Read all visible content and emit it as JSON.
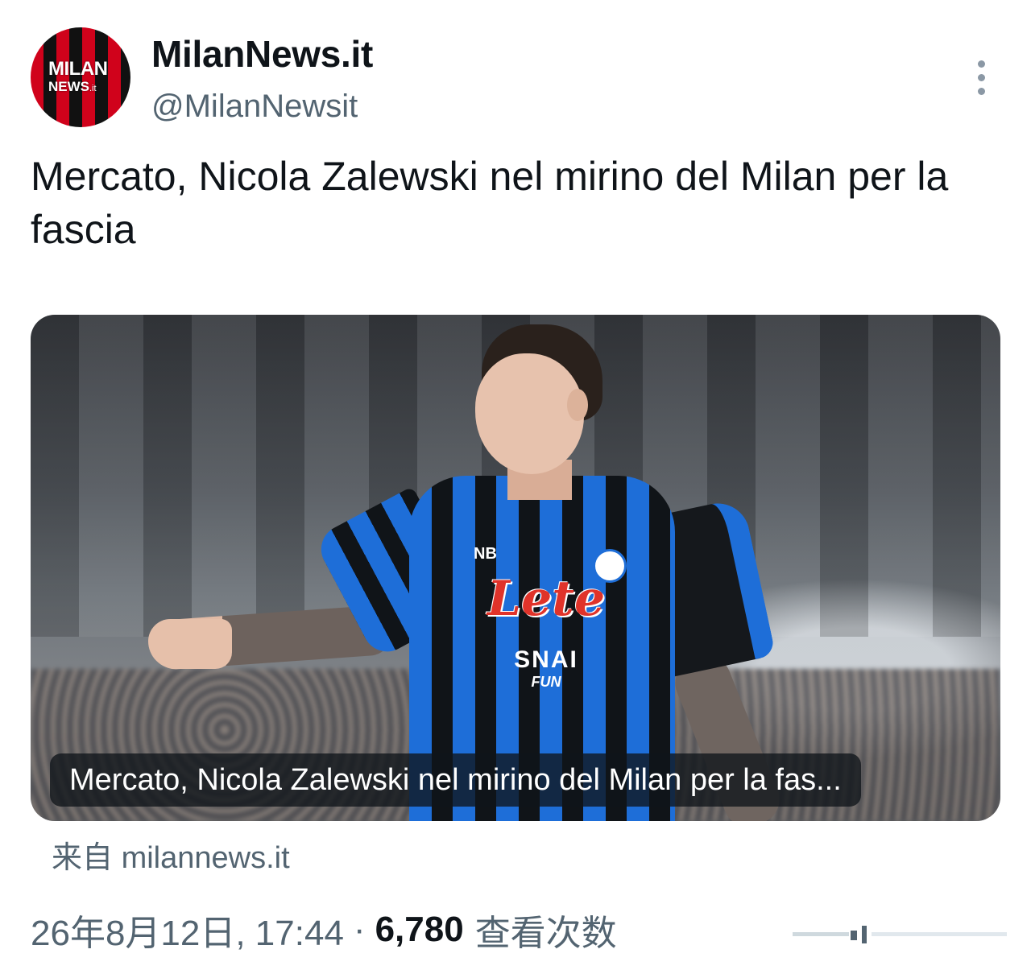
{
  "account": {
    "display_name": "MilanNews.it",
    "handle": "@MilanNewsit",
    "avatar_line1": "MILAN",
    "avatar_line2": "NEWS",
    "avatar_line2_suffix": ".it"
  },
  "tweet": {
    "text": "Mercato, Nicola Zalewski nel mirino del Milan per la fascia"
  },
  "card": {
    "caption": "Mercato, Nicola Zalewski nel mirino del Milan per la fas...",
    "source_prefix": "来自",
    "source_domain": "milannews.it",
    "photo_sponsor": "Lete",
    "photo_sponsor2": "SNAI",
    "photo_sponsor3": "FUN",
    "photo_brand": "NB"
  },
  "meta": {
    "datetime": "26年8月12日, 17:44",
    "separator": "·",
    "views_count": "6,780",
    "views_label": "查看次数"
  },
  "icons": {
    "more": "more-options-icon",
    "analytics": "analytics-bar-icon"
  },
  "colors": {
    "text_primary": "#0f1419",
    "text_secondary": "#536471",
    "avatar_red": "#d0021b",
    "avatar_black": "#111111"
  }
}
